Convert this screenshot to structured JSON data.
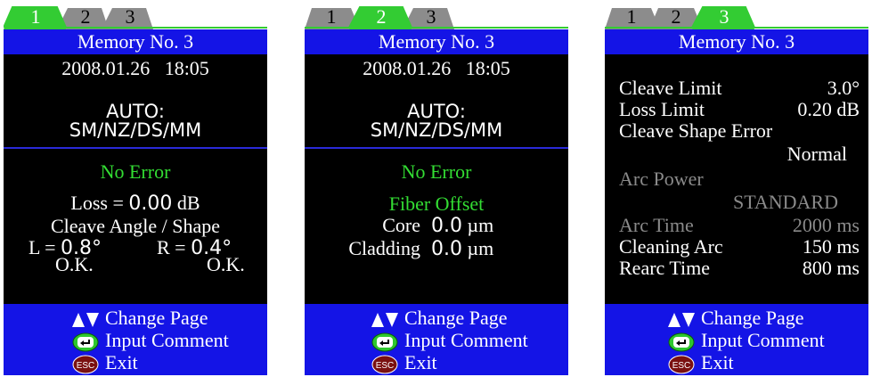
{
  "panels": [
    {
      "tabs": [
        "1",
        "2",
        "3"
      ],
      "active_tab": 1,
      "header": "Memory No. 3",
      "date": "2008.01.26",
      "time": "18:05",
      "mode_line1": "AUTO:",
      "mode_line2": "SM/NZ/DS/MM",
      "status": "No Error",
      "loss_label": "Loss = ",
      "loss_value": "0.00",
      "loss_unit": "dB",
      "cleave_title": "Cleave Angle / Shape",
      "left_label": "L = ",
      "left_value": "0.8°",
      "right_label": "R = ",
      "right_value": "0.4°",
      "left_result": "O.K.",
      "right_result": "O.K."
    },
    {
      "tabs": [
        "1",
        "2",
        "3"
      ],
      "active_tab": 2,
      "header": "Memory No. 3",
      "date": "2008.01.26",
      "time": "18:05",
      "mode_line1": "AUTO:",
      "mode_line2": "SM/NZ/DS/MM",
      "status": "No Error",
      "offset_title": "Fiber Offset",
      "core_label": "Core",
      "core_value": "0.0",
      "core_unit": "µm",
      "cladding_label": "Cladding",
      "cladding_value": "0.0",
      "cladding_unit": "µm"
    },
    {
      "tabs": [
        "1",
        "2",
        "3"
      ],
      "active_tab": 3,
      "header": "Memory No. 3",
      "cleave_limit_label": "Cleave Limit",
      "cleave_limit_value": "3.0°",
      "loss_limit_label": "Loss Limit",
      "loss_limit_value": "0.20 dB",
      "cleave_shape_label": "Cleave Shape Error",
      "cleave_shape_value": "Normal",
      "arc_power_label": "Arc Power",
      "arc_power_value": "STANDARD",
      "arc_time_label": "Arc Time",
      "arc_time_value": "2000 ms",
      "cleaning_arc_label": "Cleaning Arc",
      "cleaning_arc_value": "150 ms",
      "rearc_label": "Rearc Time",
      "rearc_value": "800 ms"
    }
  ],
  "footer": {
    "change_page": "Change Page",
    "input_comment": "Input Comment",
    "exit": "Exit",
    "esc_label": "ESC"
  },
  "colors": {
    "header_blue": "#1414e6",
    "status_green": "#33dd33",
    "tab_active": "#33cc33",
    "tab_inactive": "#8c8c8c",
    "disabled_grey": "#8a8a8a"
  }
}
